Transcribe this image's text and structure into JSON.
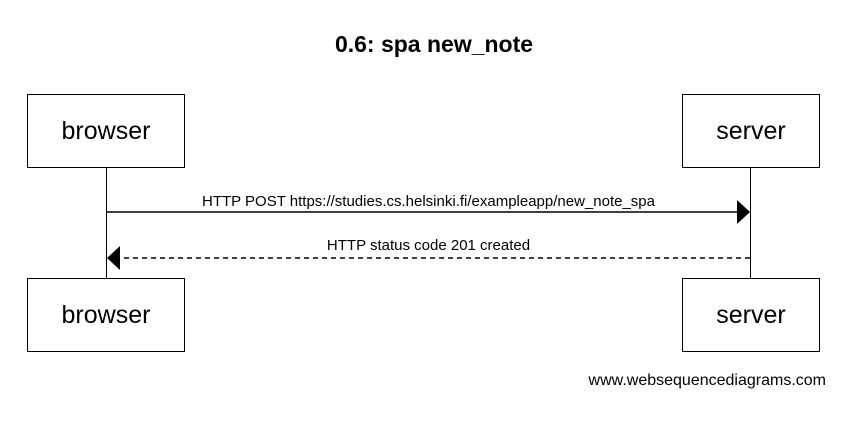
{
  "diagram": {
    "title": "0.6: spa new_note",
    "participants": {
      "browser": "browser",
      "server": "server"
    },
    "messages": [
      {
        "from": "browser",
        "to": "server",
        "style": "solid",
        "text": "HTTP POST https://studies.cs.helsinki.fi/exampleapp/new_note_spa"
      },
      {
        "from": "server",
        "to": "browser",
        "style": "dashed",
        "text": "HTTP status code 201 created"
      }
    ],
    "watermark": "www.websequencediagrams.com"
  }
}
